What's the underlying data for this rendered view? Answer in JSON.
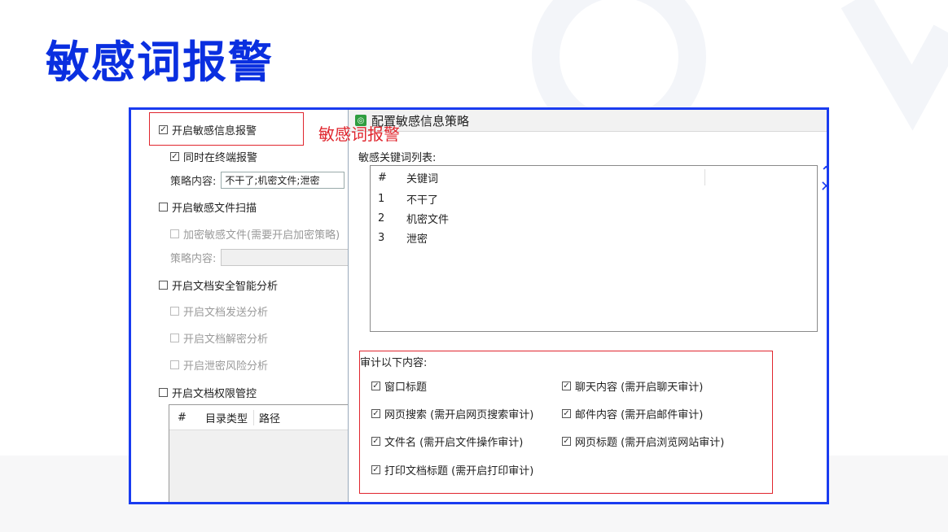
{
  "slide_title": "敏感词报警",
  "annotation": "敏感词报警",
  "left": {
    "enable_alert": "开启敏感信息报警",
    "terminal_alert": "同时在终端报警",
    "policy_label_1": "策略内容:",
    "policy_value_1": "不干了;机密文件;泄密",
    "enable_file_scan": "开启敏感文件扫描",
    "encrypt_files": "加密敏感文件(需要开启加密策略)",
    "policy_label_2": "策略内容:",
    "policy_value_2": "",
    "enable_doc_analysis": "开启文档安全智能分析",
    "doc_send": "开启文档发送分析",
    "doc_decrypt": "开启文档解密分析",
    "leak_risk": "开启泄密风险分析",
    "enable_doc_perm": "开启文档权限管控",
    "table": {
      "col_num": "#",
      "col_type": "目录类型",
      "col_path": "路径"
    }
  },
  "right": {
    "window_title": "配置敏感信息策略",
    "list_label": "敏感关键词列表:",
    "list_header": {
      "num": "#",
      "keyword": "关键词"
    },
    "keywords": [
      {
        "num": "1",
        "keyword": "不干了"
      },
      {
        "num": "2",
        "keyword": "机密文件"
      },
      {
        "num": "3",
        "keyword": "泄密"
      }
    ],
    "audit_label": "审计以下内容:",
    "audit_items": {
      "window_title": "窗口标题",
      "chat": "聊天内容 (需开启聊天审计)",
      "web_search": "网页搜索 (需开启网页搜索审计)",
      "mail": "邮件内容 (需开启邮件审计)",
      "file_name": "文件名 (需开启文件操作审计)",
      "web_title": "网页标题 (需开启浏览网站审计)",
      "print_title": "打印文档标题 (需开启打印审计)"
    }
  },
  "colors": {
    "title_blue": "#0a2fe0",
    "frame_blue": "#1a3cf0",
    "highlight_red": "#e0262e"
  },
  "icons": {
    "checkbox_checked": "☑",
    "checkbox_empty": "☐"
  }
}
